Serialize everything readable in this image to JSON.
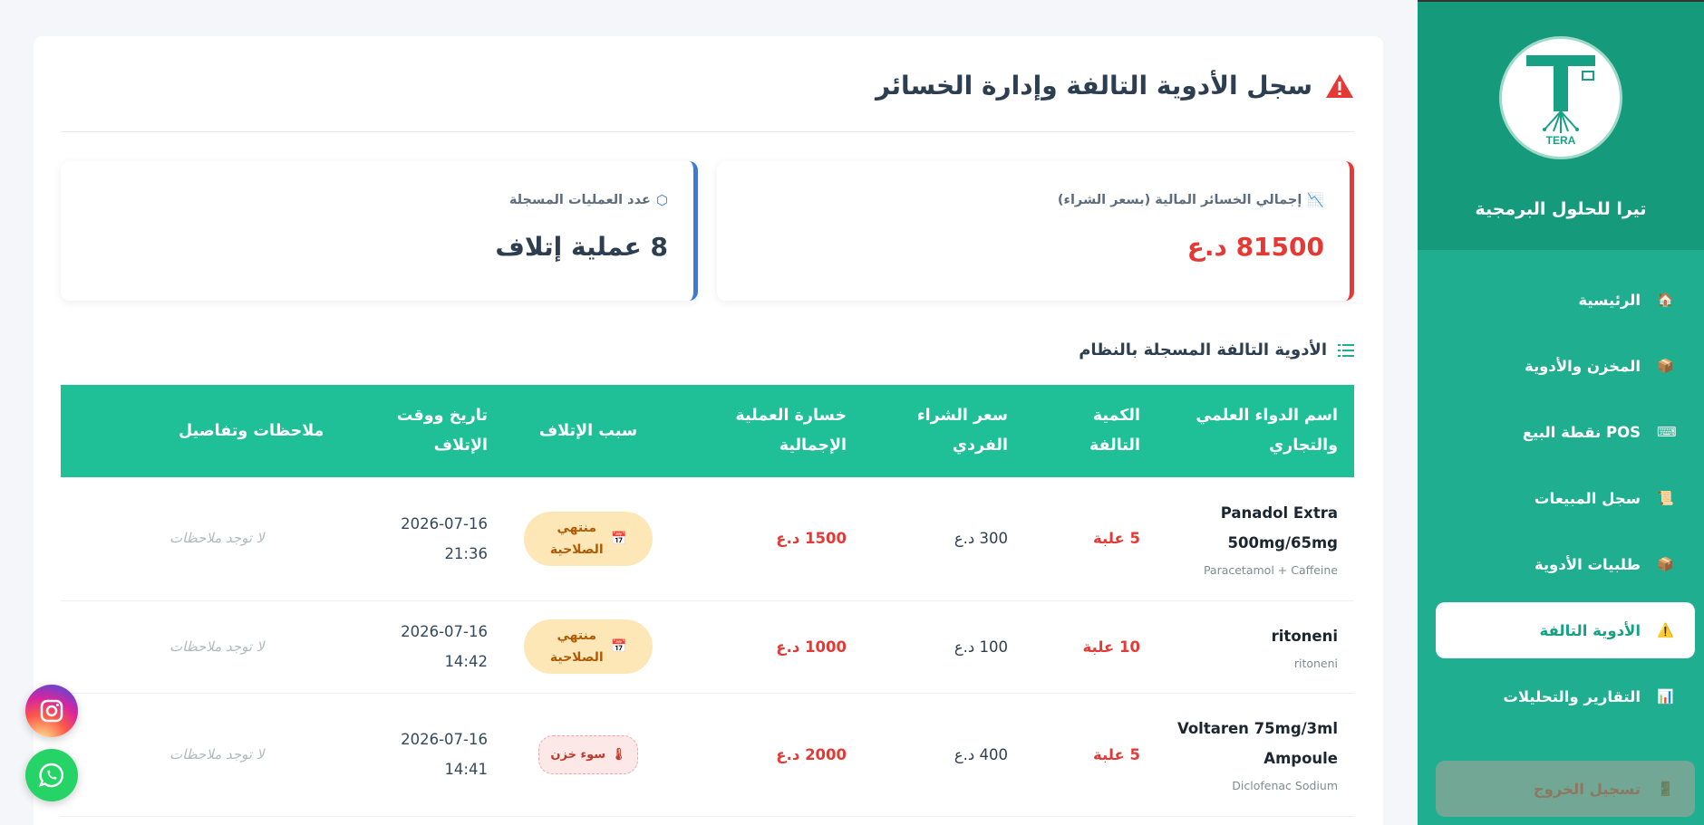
{
  "sidebar": {
    "brand_name": "تيرا للحلول البرمجية",
    "logo_text": "TERA",
    "items": [
      {
        "label": "الرئيسية",
        "icon": "house-icon"
      },
      {
        "label": "المخزن والأدوية",
        "icon": "package-icon"
      },
      {
        "label": "نقطة البيع POS",
        "icon": "pos-terminal-icon"
      },
      {
        "label": "سجل المبيعات",
        "icon": "receipt-icon"
      },
      {
        "label": "طلبيات الأدوية",
        "icon": "package-icon"
      },
      {
        "label": "الأدوية التالفة",
        "icon": "warning-icon",
        "active": true
      },
      {
        "label": "التقارير والتحليلات",
        "icon": "bar-chart-icon"
      },
      {
        "label": "تسجيل الخروج",
        "icon": "door-icon"
      }
    ]
  },
  "page": {
    "title": "سجل الأدوية التالفة وإدارة الخسائر"
  },
  "stats": {
    "loss_label": "إجمالي الخسائر المالية (بسعر الشراء)",
    "loss_value": "81500 د.ع",
    "ops_label": "عدد العمليات المسجلة",
    "ops_value": "8 عملية إتلاف"
  },
  "section": {
    "title": "الأدوية التالفة المسجلة بالنظام"
  },
  "table": {
    "headers": [
      "اسم الدواء العلمي والتجاري",
      "الكمية التالفة",
      "سعر الشراء الفردي",
      "خسارة العملية الإجمالية",
      "سبب الإتلاف",
      "تاريخ ووقت الإتلاف",
      "ملاحظات وتفاصيل"
    ],
    "rows": [
      {
        "name": "Panadol Extra 500mg/65mg",
        "generic": "Paracetamol + Caffeine",
        "qty": "5 علبة",
        "price": "300 د.ع",
        "loss": "1500 د.ع",
        "reason": "منتهي الصلاحية",
        "date": "2026-07-16",
        "time": "21:36",
        "notes": "لا توجد ملاحظات"
      },
      {
        "name": "ritoneni",
        "generic": "ritoneni",
        "qty": "10 علبة",
        "price": "100 د.ع",
        "loss": "1000 د.ع",
        "reason": "منتهي الصلاحية",
        "date": "2026-07-16",
        "time": "14:42",
        "notes": "لا توجد ملاحظات"
      },
      {
        "name": "Voltaren 75mg/3ml Ampoule",
        "generic": "Diclofenac Sodium",
        "qty": "5 علبة",
        "price": "400 د.ع",
        "loss": "2000 د.ع",
        "reason": "سوء خزن",
        "date": "2026-07-16",
        "time": "14:41",
        "notes": "لا توجد ملاحظات"
      }
    ]
  },
  "social": {
    "instagram": "instagram-icon",
    "whatsapp": "whatsapp-icon"
  },
  "colors": {
    "primary": "#1fae8f",
    "header": "#1fbf98",
    "danger": "#e53935",
    "info": "#3a7bd5"
  }
}
